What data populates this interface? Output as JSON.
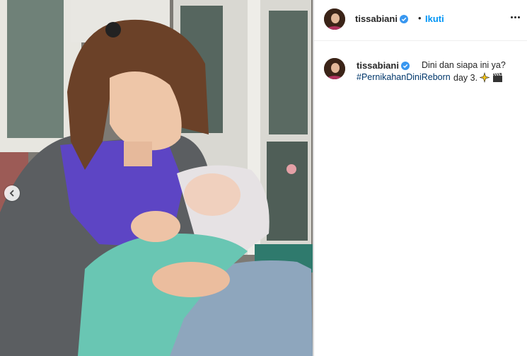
{
  "post": {
    "username": "tissabiani",
    "separator": "•",
    "follow_label": "Ikuti",
    "caption_text": "Dini dan siapa ini ya?",
    "hashtag": "#PernikahanDiniReborn",
    "caption_tail": "day 3.",
    "icons": [
      "verified-icon",
      "more-options-icon",
      "sparkles-icon",
      "clapper-board-icon",
      "chevron-left-icon"
    ],
    "colors": {
      "link": "#0095f6",
      "hashtag": "#00376b",
      "verified": "#3897f0"
    }
  }
}
